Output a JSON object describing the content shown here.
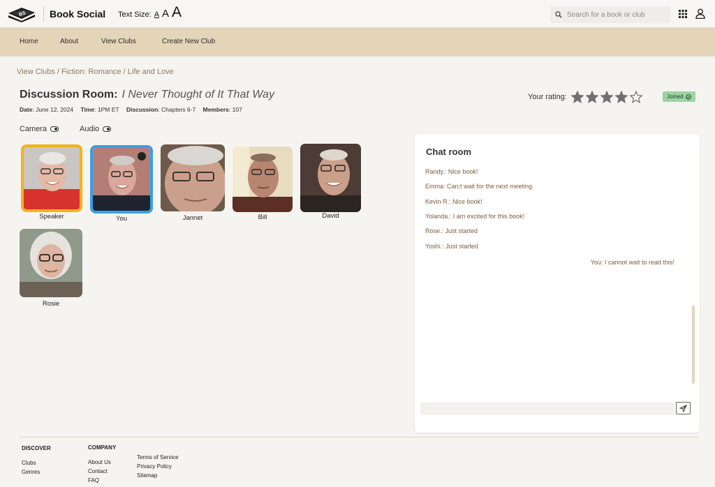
{
  "header": {
    "logo_text": "BS",
    "brand": "Book Social",
    "text_size_label": "Text Size:",
    "text_size_options": [
      "A",
      "A",
      "A"
    ],
    "search_placeholder": "Search for a book or club"
  },
  "nav": {
    "items": [
      "Home",
      "About",
      "View Clubs",
      "Create New Club"
    ]
  },
  "breadcrumb": {
    "items": [
      "View Clubs",
      "Fiction: Romance",
      "Life and Love"
    ],
    "separator": " / "
  },
  "room": {
    "title_prefix": "Discussion Room:",
    "book_title": "I Never Thought of It That Way",
    "date_label": "Date",
    "date": "June 12, 2024",
    "time_label": "Time",
    "time": "1PM ET",
    "discussion_label": "Discussion",
    "discussion": "Chapters 6-7",
    "members_label": "Members",
    "members": "107",
    "rating_label": "Your rating:",
    "rating_value": 4,
    "rating_max": 5,
    "joined_label": "Joined"
  },
  "controls": {
    "camera_label": "Camera",
    "audio_label": "Audio"
  },
  "participants": [
    {
      "name": "Speaker",
      "highlight": "#f6b21a"
    },
    {
      "name": "You",
      "highlight": "#3aa0e0"
    },
    {
      "name": "Jannet",
      "highlight": ""
    },
    {
      "name": "Bill",
      "highlight": ""
    },
    {
      "name": "David",
      "highlight": ""
    },
    {
      "name": "Rosie",
      "highlight": ""
    }
  ],
  "chat": {
    "title": "Chat room",
    "messages": [
      {
        "text": "Randy.: Nice book!",
        "mine": false
      },
      {
        "text": "Emma: Can;t wait for the next meeting.",
        "mine": false
      },
      {
        "text": "Kevin R.: Nice book!",
        "mine": false
      },
      {
        "text": "Yolanda.: I am excited for this book!",
        "mine": false
      },
      {
        "text": "Rose.: Just started",
        "mine": false
      },
      {
        "text": "Yoshi.: Just started",
        "mine": false
      },
      {
        "text": "You: I cannot wait to read this!",
        "mine": true
      }
    ]
  },
  "footer": {
    "discover_heading": "DISCOVER",
    "discover_links": [
      "Clubs",
      "Genres"
    ],
    "company_heading": "COMPANY",
    "company_links": [
      "About Us",
      "Contact",
      "FAQ"
    ],
    "legal_links": [
      "Terms of Service",
      "Privacy Policy",
      "Sitemap"
    ]
  },
  "colors": {
    "nav_bg": "#e5d5b8",
    "chat_text": "#7d5a3c",
    "joined_bg": "#9dd3a3",
    "speaker_border": "#f6b21a",
    "you_border": "#3aa0e0"
  }
}
